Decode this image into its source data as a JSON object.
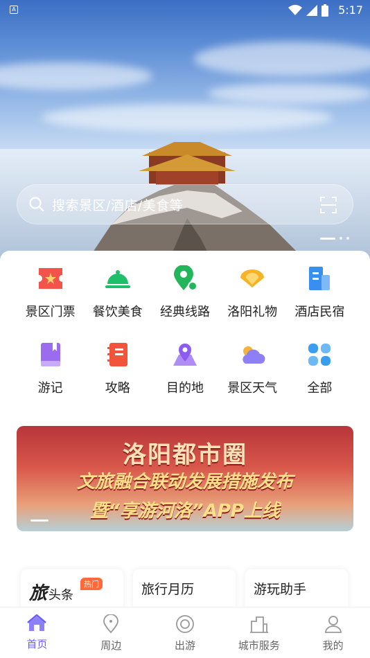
{
  "status_bar": {
    "time": "5:17",
    "left_badge": "A"
  },
  "search": {
    "placeholder": "搜索景区/酒店/美食等"
  },
  "categories": [
    {
      "label": "景区门票",
      "icon": "ticket-icon",
      "color": "#f2534b"
    },
    {
      "label": "餐饮美食",
      "icon": "food-cloche-icon",
      "color": "#1fbf6a"
    },
    {
      "label": "经典线路",
      "icon": "route-pin-icon",
      "color": "#22b55a"
    },
    {
      "label": "洛阳礼物",
      "icon": "gift-fan-icon",
      "color": "#f5b428"
    },
    {
      "label": "酒店民宿",
      "icon": "hotel-building-icon",
      "color": "#3a8ef0"
    },
    {
      "label": "游记",
      "icon": "notebook-icon",
      "color": "#9b6cf0"
    },
    {
      "label": "攻略",
      "icon": "guide-book-icon",
      "color": "#f2533b"
    },
    {
      "label": "目的地",
      "icon": "destination-map-icon",
      "color": "#8d5cf0"
    },
    {
      "label": "景区天气",
      "icon": "weather-icon",
      "color": "#7b6cf6"
    },
    {
      "label": "全部",
      "icon": "all-grid-icon",
      "color": "#3a9ef0"
    }
  ],
  "banner": {
    "line1": "洛阳都市圈",
    "line2": "文旅融合联动发展措施发布",
    "line3": "暨“享游河洛”APP上线"
  },
  "tiles": [
    {
      "big": "旅",
      "small": "头条",
      "badge": "热门"
    },
    {
      "label": "旅行月历"
    },
    {
      "label": "游玩助手"
    }
  ],
  "nav": [
    {
      "label": "首页",
      "icon": "home-icon",
      "active": true
    },
    {
      "label": "周边",
      "icon": "location-pin-icon",
      "active": false
    },
    {
      "label": "出游",
      "icon": "travel-circle-icon",
      "active": false
    },
    {
      "label": "城市服务",
      "icon": "city-building-icon",
      "active": false
    },
    {
      "label": "我的",
      "icon": "user-profile-icon",
      "active": false
    }
  ],
  "colors": {
    "accent": "#6a5cff"
  }
}
